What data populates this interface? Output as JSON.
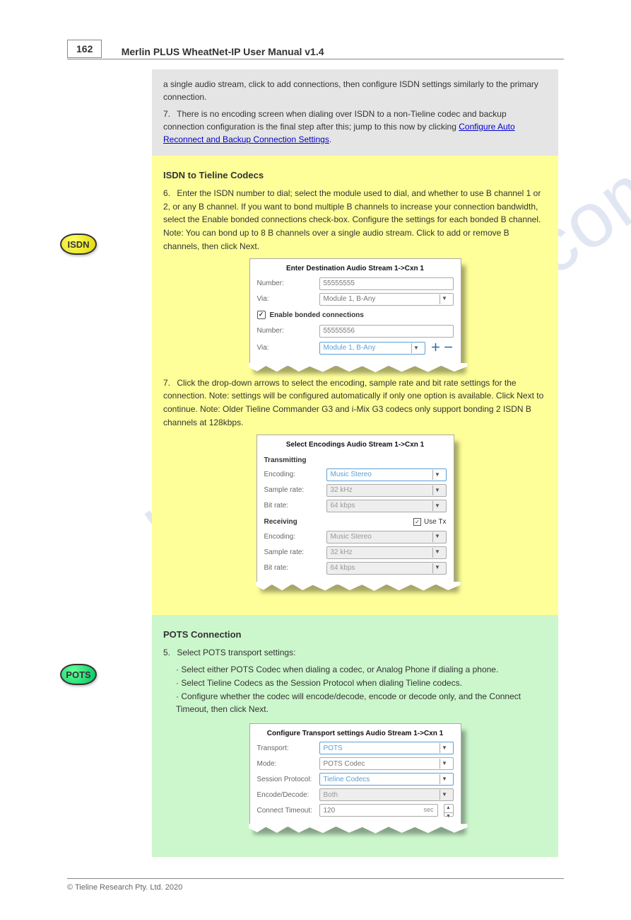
{
  "page_number": "162",
  "header_title": "Merlin PLUS WheatNet-IP User Manual v1.4",
  "watermark": "manualshive.com",
  "gray": {
    "text_top": "a single audio stream, click to add connections, then configure ISDN settings similarly to the primary connection.",
    "num": "7.",
    "text_num": "There is no encoding screen when dialing over ISDN to a non-Tieline codec and backup connection configuration is the final step after this; jump to this now by clicking",
    "link": "Configure Auto Reconnect and Backup Connection Settings"
  },
  "isdn": {
    "title": "ISDN to Tieline Codecs",
    "p1_num": "6.",
    "p1_text": "Enter the ISDN number to dial; select the module used to dial, and whether to use B channel 1 or 2, or any B channel. If you want to bond multiple B channels to increase your connection bandwidth, select the Enable bonded connections check-box. Configure the settings for each bonded B channel. Note: You can bond up to 8 B channels over a single audio stream. Click to add or remove B channels, then click Next.",
    "p2_num": "7.",
    "p2_text": "Click the drop-down arrows to select the encoding, sample rate and bit rate settings for the connection. Note: settings will be configured automatically if only one option is available. Click Next to continue. Note: Older Tieline Commander G3 and i-Mix G3 codecs only support bonding 2 ISDN B channels at 128kbps.",
    "dialog1": {
      "title": "Enter Destination Audio Stream 1->Cxn 1",
      "row1": {
        "label": "Number:",
        "value": "55555555"
      },
      "row2": {
        "label": "Via:",
        "value": "Module 1, B-Any"
      },
      "check": "Enable bonded connections",
      "row3": {
        "label": "Number:",
        "value": "55555556"
      },
      "row4": {
        "label": "Via:",
        "value": "Module 1, B-Any"
      }
    },
    "dialog2": {
      "title": "Select Encodings Audio Stream 1->Cxn 1",
      "sec1": "Transmitting",
      "t_enc": {
        "label": "Encoding:",
        "value": "Music Stereo"
      },
      "t_sr": {
        "label": "Sample rate:",
        "value": "32 kHz"
      },
      "t_br": {
        "label": "Bit rate:",
        "value": "64 kbps"
      },
      "sec2": "Receiving",
      "use_tx": "Use Tx",
      "r_enc": {
        "label": "Encoding:",
        "value": "Music Stereo"
      },
      "r_sr": {
        "label": "Sample rate:",
        "value": "32 kHz"
      },
      "r_br": {
        "label": "Bit rate:",
        "value": "64 kbps"
      }
    }
  },
  "pots": {
    "title": "POTS Connection",
    "p1_num": "5.",
    "p1_text": "Select POTS transport settings:",
    "bullets": {
      "b1": "Select either POTS Codec when dialing a codec, or Analog Phone if dialing a phone.",
      "b2": "Select Tieline Codecs as the Session Protocol when dialing Tieline codecs.",
      "b3": "Configure whether the codec will encode/decode, encode or decode only, and the Connect Timeout, then click Next."
    },
    "dialog": {
      "title": "Configure Transport settings Audio Stream 1->Cxn 1",
      "r1": {
        "label": "Transport:",
        "value": "POTS"
      },
      "r2": {
        "label": "Mode:",
        "value": "POTS Codec"
      },
      "r3": {
        "label": "Session Protocol:",
        "value": "Tieline Codecs"
      },
      "r4": {
        "label": "Encode/Decode:",
        "value": "Both"
      },
      "r5": {
        "label": "Connect Timeout:",
        "value": "120",
        "suffix": "sec"
      }
    }
  },
  "footer_left": "© Tieline Research Pty. Ltd. 2020",
  "badge_isdn": "ISDN",
  "badge_pots": "POTS"
}
